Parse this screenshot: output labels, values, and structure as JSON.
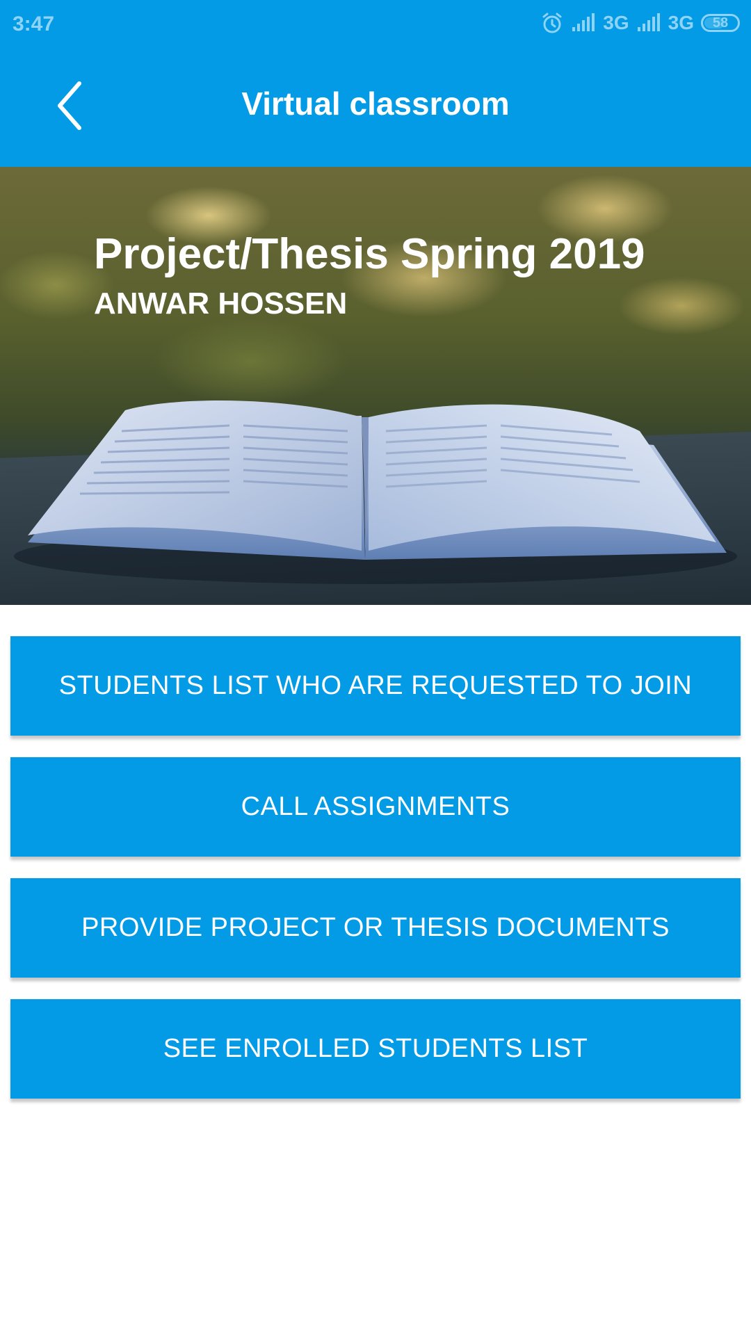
{
  "status_bar": {
    "time": "3:47",
    "network_1": "3G",
    "network_2": "3G",
    "battery": "58",
    "icons": [
      "alarm-icon",
      "signal-icon",
      "signal-icon",
      "battery-icon"
    ]
  },
  "toolbar": {
    "back_icon": "chevron-left-icon",
    "title": "Virtual classroom"
  },
  "banner": {
    "title": "Project/Thesis Spring 2019",
    "subtitle": "ANWAR HOSSEN"
  },
  "actions": [
    {
      "label": "STUDENTS LIST WHO ARE REQUESTED TO JOIN"
    },
    {
      "label": "CALL ASSIGNMENTS"
    },
    {
      "label": "PROVIDE PROJECT OR THESIS DOCUMENTS"
    },
    {
      "label": "SEE ENROLLED STUDENTS LIST"
    }
  ],
  "colors": {
    "primary": "#039be5",
    "text_on_primary": "#ffffff",
    "background": "#ffffff"
  }
}
